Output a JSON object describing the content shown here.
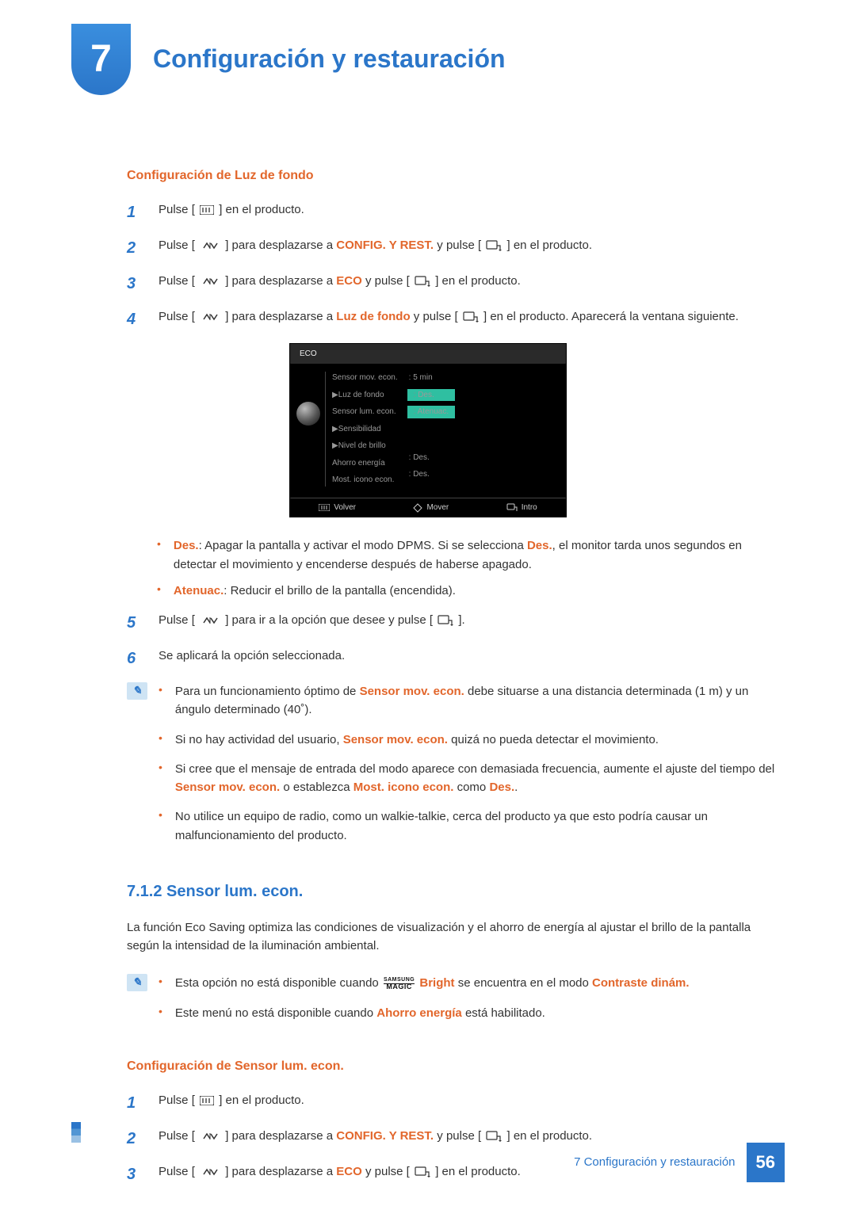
{
  "chapter": {
    "number": "7",
    "title": "Configuración y restauración"
  },
  "s1": {
    "heading": "Configuración de Luz de fondo",
    "steps": {
      "1": {
        "pre": "Pulse [",
        "post": " ] en el producto."
      },
      "2": {
        "pre": "Pulse [",
        "mid1": "] para desplazarse a ",
        "hl": "CONFIG. Y REST.",
        "mid2": " y pulse [",
        "post": "] en el producto."
      },
      "3": {
        "pre": "Pulse [",
        "mid1": "] para desplazarse a ",
        "hl": "ECO",
        "mid2": " y pulse [",
        "post": "] en el producto."
      },
      "4": {
        "pre": "Pulse [",
        "mid1": "] para desplazarse a ",
        "hl": "Luz de fondo",
        "mid2": " y pulse [",
        "post": "] en el producto. Aparecerá la ventana siguiente."
      },
      "5": {
        "pre": "Pulse [",
        "mid": "] para ir a la opción que desee y pulse [",
        "post": "]."
      },
      "6": "Se aplicará la opción seleccionada."
    }
  },
  "osd": {
    "title": "ECO",
    "labels": {
      "l1": "Sensor mov. econ.",
      "l2": "Luz de fondo",
      "l3": "Sensor lum. econ.",
      "l4": "Sensibilidad",
      "l5": "Nivel de brillo",
      "l6": "Ahorro energía",
      "l7": "Most. icono econ."
    },
    "vals": {
      "v1": "5 min",
      "v2": "Des.",
      "v3": "Atenuac.",
      "v6": "Des.",
      "v7": "Des."
    },
    "footer": {
      "back": "Volver",
      "move": "Mover",
      "enter": "Intro"
    }
  },
  "bullets": {
    "b1": {
      "hl1": "Des.",
      "t1": ": Apagar la pantalla y activar el modo DPMS. Si se selecciona ",
      "hl2": "Des.",
      "t2": ", el monitor tarda unos segundos en detectar el movimiento y encenderse después de haberse apagado."
    },
    "b2": {
      "hl": "Atenuac.",
      "t": ": Reducir el brillo de la pantalla (encendida)."
    }
  },
  "info1": {
    "i1": {
      "a": "Para un funcionamiento óptimo de ",
      "hl": "Sensor mov. econ.",
      "b": " debe situarse a una distancia determinada (1 m) y un ángulo determinado (40˚)."
    },
    "i2": {
      "a": "Si no hay actividad del usuario, ",
      "hl": "Sensor mov. econ.",
      "b": " quizá no pueda detectar el movimiento."
    },
    "i3": {
      "a": "Si cree que el mensaje de entrada del modo aparece con demasiada frecuencia, aumente el ajuste del tiempo del ",
      "hl1": "Sensor mov. econ.",
      "mid": " o establezca ",
      "hl2": "Most. icono econ.",
      "mid2": " como ",
      "hl3": "Des.",
      "end": "."
    },
    "i4": "No utilice un equipo de radio, como un walkie-talkie, cerca del producto ya que esto podría causar un malfuncionamiento del producto."
  },
  "s712": {
    "heading": "7.1.2   Sensor lum. econ.",
    "para": "La función Eco Saving optimiza las condiciones de visualización y el ahorro de energía al ajustar el brillo de la pantalla según la intensidad de la iluminación ambiental."
  },
  "info2": {
    "i1": {
      "a": "Esta opción no está disponible cuando ",
      "hl": "Bright",
      "b": " se encuentra en el modo ",
      "hl2": "Contraste dinám."
    },
    "i2": {
      "a": "Este menú no está disponible cuando ",
      "hl": "Ahorro energía",
      "b": " está habilitado."
    }
  },
  "s2": {
    "heading": "Configuración de Sensor lum. econ.",
    "steps": {
      "1": {
        "pre": "Pulse [",
        "post": " ] en el producto."
      },
      "2": {
        "pre": "Pulse [",
        "mid1": "] para desplazarse a ",
        "hl": "CONFIG. Y REST.",
        "mid2": " y pulse [",
        "post": "] en el producto."
      },
      "3": {
        "pre": "Pulse [",
        "mid1": "] para desplazarse a ",
        "hl": "ECO",
        "mid2": " y pulse [",
        "post": "] en el producto."
      }
    }
  },
  "footer": {
    "text": "7 Configuración y restauración",
    "page": "56"
  },
  "magic": {
    "top": "SAMSUNG",
    "bot": "MAGIC"
  }
}
